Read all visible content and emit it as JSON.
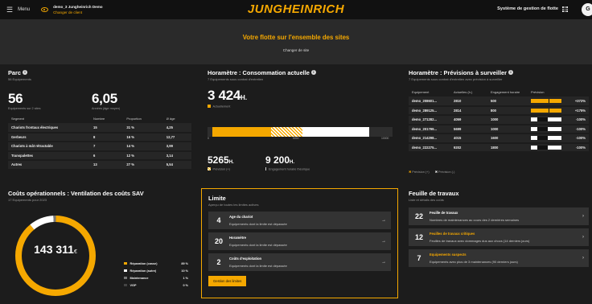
{
  "topbar": {
    "menu_label": "Menu",
    "client_name": "demo_3 Jungheinrich Demo",
    "client_change": "Changer de client",
    "logo_text": "JUNGHEINRICH",
    "system_name": "Système de gestion de flotte",
    "avatar_letter": "G"
  },
  "hero": {
    "title": "Votre flotte sur l'ensemble des sites",
    "link": "Changer de site"
  },
  "parc": {
    "title": "Parc",
    "subtitle": "56 Equipements",
    "count_value": "56",
    "count_label": "Equipements sur 2 sites",
    "age_value": "6,05",
    "age_label": "Années (âge moyen)",
    "columns": [
      "Segment",
      "Nombre",
      "Proportion",
      "Ø âge"
    ],
    "rows": [
      {
        "segment": "Chariots frontaux électriques",
        "nombre": "15",
        "proportion": "31 %",
        "age": "4,25"
      },
      {
        "segment": "Gerbeurs",
        "nombre": "8",
        "proportion": "16 %",
        "age": "12,77"
      },
      {
        "segment": "Chariots à mât rétractable",
        "nombre": "7",
        "proportion": "14 %",
        "age": "3,99"
      },
      {
        "segment": "Transpalettes",
        "nombre": "6",
        "proportion": "12 %",
        "age": "3,14"
      },
      {
        "segment": "Autres",
        "nombre": "13",
        "proportion": "27 %",
        "age": "5,54"
      }
    ]
  },
  "horametre": {
    "title": "Horamètre : Consommation actuelle",
    "subtitle": "7 Equipements sous contrat d'entretien",
    "value": "3 424",
    "unit": "H.",
    "legend_actual": "Actuellement",
    "scale_labels": [
      "0",
      "5000",
      "10000"
    ],
    "bar_max": 10000,
    "actual_value": 3424,
    "prevision_value": 5265,
    "engagement_value": 9200,
    "prevision_display": "5265",
    "engagement_display": "9 200",
    "prevision_unit": "H.",
    "engagement_unit": "H.",
    "prevision_label": "Prévision (+)",
    "engagement_label": "Engagement horaire théorique"
  },
  "previsions": {
    "title": "Horamètre : Prévisions à surveiller",
    "subtitle": "7 Equipements sous contrat d'entretien avec prévision à surveiller",
    "columns": [
      "Equipement",
      "Actuelles (h.)",
      "Engagement horaire",
      "Prévision"
    ],
    "rows": [
      {
        "equipement": "demo_208601...",
        "actuelles": "2810",
        "engagement": "500",
        "prevision": "+372%",
        "fill": 1.0,
        "color": "#f5a800"
      },
      {
        "equipement": "demo_289125...",
        "actuelles": "2814",
        "engagement": "800",
        "prevision": "+175%",
        "fill": 1.0,
        "color": "#f5a800"
      },
      {
        "equipement": "demo_271282...",
        "actuelles": "4059",
        "engagement": "1000",
        "prevision": "-100%",
        "fill": 1.0,
        "color": "#ffffff"
      },
      {
        "equipement": "demo_201799...",
        "actuelles": "5699",
        "engagement": "1000",
        "prevision": "-100%",
        "fill": 1.0,
        "color": "#ffffff"
      },
      {
        "equipement": "demo_214298...",
        "actuelles": "4015",
        "engagement": "1600",
        "prevision": "-100%",
        "fill": 1.0,
        "color": "#ffffff"
      },
      {
        "equipement": "demo_222275...",
        "actuelles": "9202",
        "engagement": "1800",
        "prevision": "-100%",
        "fill": 1.0,
        "color": "#ffffff"
      }
    ],
    "legend_plus": "Prévision (+)",
    "legend_minus": "Prévision (-)"
  },
  "couts": {
    "title": "Coûts opérationnels : Ventilation des coûts SAV",
    "subtitle": "17 Equipements pour 2023",
    "total": "143 311",
    "currency": "€",
    "legend": [
      {
        "name": "Réparation (casse)",
        "pct": "89 %",
        "value": 89,
        "color": "#f5a800"
      },
      {
        "name": "Réparation (autre)",
        "pct": "10 %",
        "value": 10,
        "color": "#ffffff"
      },
      {
        "name": "Maintenance",
        "pct": "1 %",
        "value": 1,
        "color": "#777777"
      },
      {
        "name": "VGP",
        "pct": "0 %",
        "value": 0,
        "color": "#444444"
      }
    ]
  },
  "limite": {
    "title": "Limite",
    "subtitle": "Aperçu de toutes les limites actives",
    "items": [
      {
        "num": "4",
        "title": "Age du chariot",
        "desc": "Equipements dont la limite est dépassée"
      },
      {
        "num": "20",
        "title": "Horamètre",
        "desc": "Equipements dont la limite est dépassée"
      },
      {
        "num": "2",
        "title": "Coûts d'exploitation",
        "desc": "Equipements dont la limite est dépassée"
      }
    ],
    "button": "Gestion des limites"
  },
  "travaux": {
    "title": "Feuille de travaux",
    "subtitle": "Liste et détails des coûts",
    "items": [
      {
        "num": "22",
        "title": "Feuille de travaux",
        "desc": "Nombres de maintenances au cours des 2 dernières semaines"
      },
      {
        "num": "12",
        "title": "Feuilles de travaux critiques",
        "desc": "Feuilles de travaux avec dommages dus aux chocs (14 derniers jours)"
      },
      {
        "num": "7",
        "title": "Equipements suspects",
        "desc": "Equipements avec plus de 3 maintenances (90 derniers jours)"
      }
    ]
  }
}
